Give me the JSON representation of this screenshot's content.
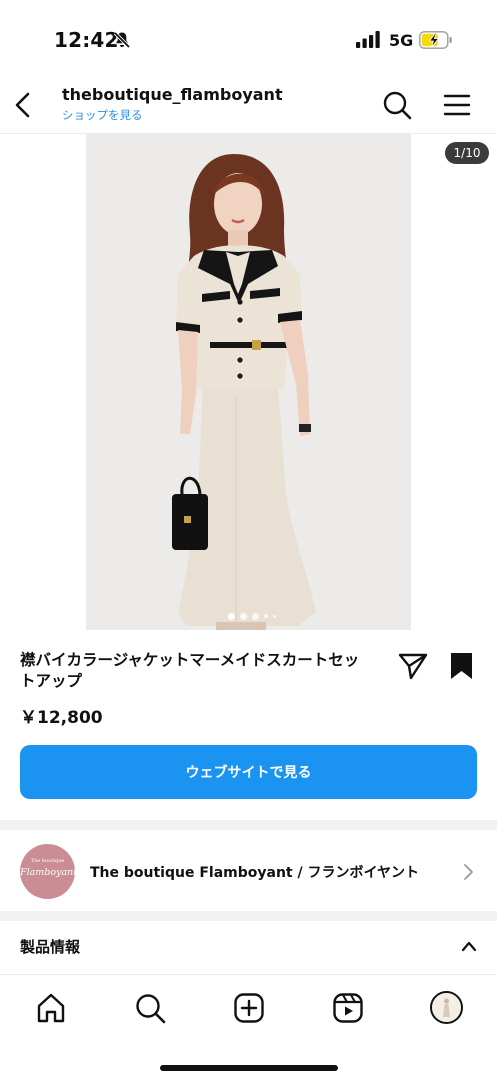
{
  "status_bar": {
    "time": "12:42",
    "network": "5G"
  },
  "header": {
    "shop_name": "theboutique_flamboyant",
    "shop_link": "ショップを見る"
  },
  "product": {
    "image_counter": "1/10",
    "image_count_dots": 6,
    "active_dot": 1,
    "title": "襟バイカラージャケットマーメイドスカートセットアップ",
    "price": "￥12,800",
    "cta_label": "ウェブサイトで見る"
  },
  "seller": {
    "avatar_small_text": "The boutique",
    "avatar_big_text": "Flamboyant",
    "name": "The boutique Flamboyant / フランボイヤント"
  },
  "info_section": {
    "title": "製品情報"
  },
  "colors": {
    "accent": "#1a94f0",
    "link": "#2a8fe6",
    "avatar_bg": "#c98d93",
    "image_bg": "#eeeceb"
  },
  "icons": {
    "status": [
      "bell-slash-icon",
      "signal-icon",
      "battery-charging-icon"
    ],
    "header": [
      "back-icon",
      "search-icon",
      "menu-icon"
    ],
    "product": [
      "share-icon",
      "bookmark-icon"
    ],
    "nav": [
      "home-icon",
      "search-icon",
      "create-icon",
      "reels-icon",
      "profile-avatar"
    ]
  }
}
